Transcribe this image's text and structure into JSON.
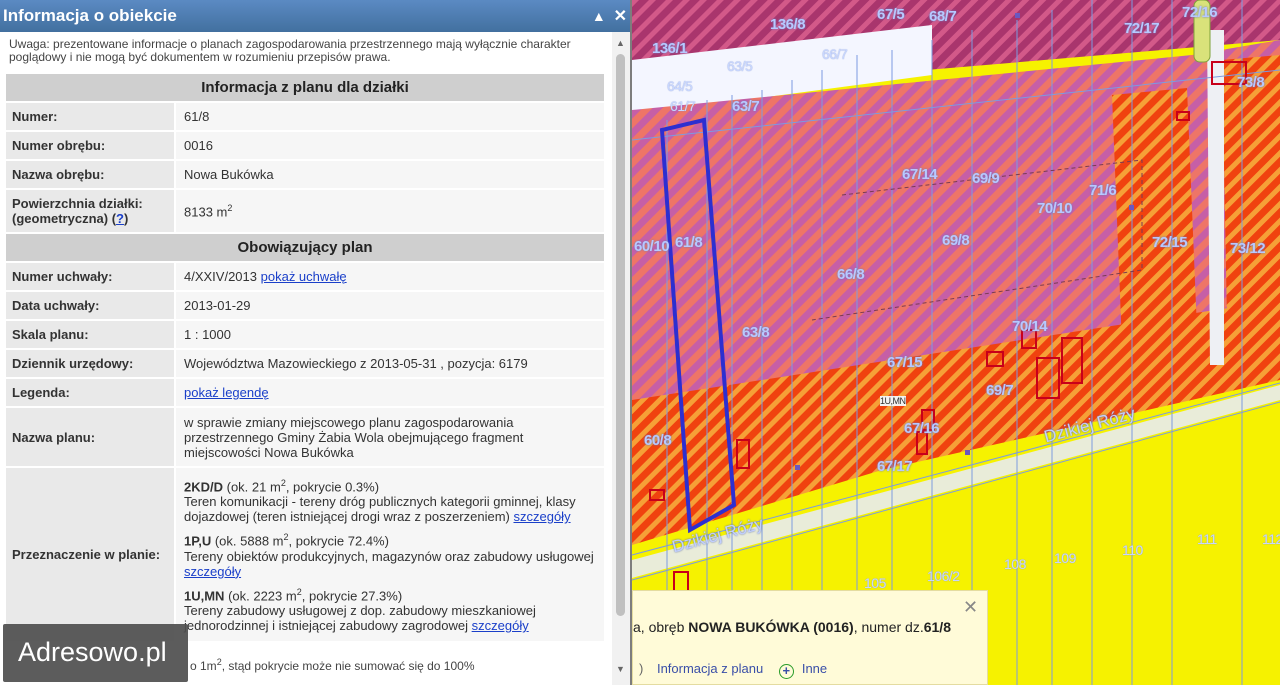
{
  "panel": {
    "title": "Informacja o obiekcie",
    "collapse_icon": "▲",
    "close_icon": "✕",
    "notice": "Uwaga: prezentowane informacje o planach zagospodarowania przestrzennego mają wyłącznie charakter poglądowy i nie mogą być dokumentem w rozumieniu przepisów prawa."
  },
  "parcel": {
    "section_title": "Informacja z planu dla działki",
    "number_label": "Numer:",
    "number": "61/8",
    "precinct_no_label": "Numer obrębu:",
    "precinct_no": "0016",
    "precinct_name_label": "Nazwa obrębu:",
    "precinct_name": "Nowa Bukówka",
    "area_label_1": "Powierzchnia działki:",
    "area_label_2": "(geometryczna) (",
    "area_help": "?",
    "area_label_3": ")",
    "area_value": "8133 m",
    "area_unit_sup": "2"
  },
  "plan": {
    "section_title": "Obowiązujący plan",
    "resolution_no_label": "Numer uchwały:",
    "resolution_no": "4/XXIV/2013",
    "resolution_link": "pokaż uchwałę",
    "resolution_date_label": "Data uchwały:",
    "resolution_date": "2013-01-29",
    "scale_label": "Skala planu:",
    "scale": "1 : 1000",
    "journal_label": "Dziennik urzędowy:",
    "journal": "Województwa Mazowieckiego z 2013-05-31 , pozycja: 6179",
    "legend_label": "Legenda:",
    "legend_link": "pokaż legendę",
    "name_label": "Nazwa planu:",
    "name": "w sprawie zmiany miejscowego planu zagospodarowania przestrzennego Gminy Żabia Wola obejmującego fragment miejscowości Nowa Bukówka",
    "purpose_label": "Przeznaczenie w planie:",
    "purposes": [
      {
        "code": "2KD/D",
        "pre": " (ok. 21 m",
        "sup": "2",
        "post": ", pokrycie 0.3%)",
        "desc": "Teren komunikacji - tereny dróg publicznych kategorii gminnej, klasy dojazdowej (teren istniejącej drogi wraz z poszerzeniem) ",
        "link": "szczegóły"
      },
      {
        "code": "1P,U",
        "pre": " (ok. 5888 m",
        "sup": "2",
        "post": ", pokrycie 72.4%)",
        "desc": "Tereny obiektów produkcyjnych, magazynów oraz zabudowy usługowej ",
        "link": "szczegóły"
      },
      {
        "code": "1U,MN",
        "pre": " (ok. 2223 m",
        "sup": "2",
        "post": ", pokrycie 27.3%)",
        "desc": "Tereny zabudowy usługowej z dop. zabudowy mieszkaniowej jednorodzinnej i istniejącej zabudowy zagrodowej ",
        "link": "szczegóły"
      }
    ],
    "footnote_pre": "o 1m",
    "footnote_sup": "2",
    "footnote_post": ", stąd pokrycie może nie sumować się do 100%"
  },
  "watermark": "Adresowo.pl",
  "map": {
    "labels": [
      "136/8",
      "67/5",
      "68/7",
      "72/17",
      "72/16",
      "136/1",
      "63/5",
      "66/7",
      "64/5",
      "61/7",
      "63/7",
      "73/8",
      "67/14",
      "69/9",
      "71/6",
      "70/10",
      "61/8",
      "69/8",
      "72/15",
      "60/10",
      "73/12",
      "66/8",
      "63/8",
      "70/14",
      "67/15",
      "69/7",
      "67/16",
      "60/8",
      "67/17",
      "105",
      "106/2",
      "108",
      "109",
      "110",
      "111",
      "112",
      "1U,MN"
    ],
    "road_name": "Dzikiej Róży",
    "road_name_2": "Dzikiej Róży",
    "popup": {
      "close": "✕",
      "line_start": "a",
      "line_mid": ", obręb ",
      "precinct": "NOWA BUKÓWKA (0016)",
      "line_mid2": ", numer dz.",
      "parcel": "61/8",
      "link_prefix": ")",
      "link_plan": "Informacja z planu",
      "link_other": "Inne"
    },
    "colors": {
      "orange_zone": "#f36a2a",
      "pink_zone": "#d85a9a",
      "yellow_zone": "#f6f200",
      "parcel_outline": "#2d2fd0"
    }
  }
}
